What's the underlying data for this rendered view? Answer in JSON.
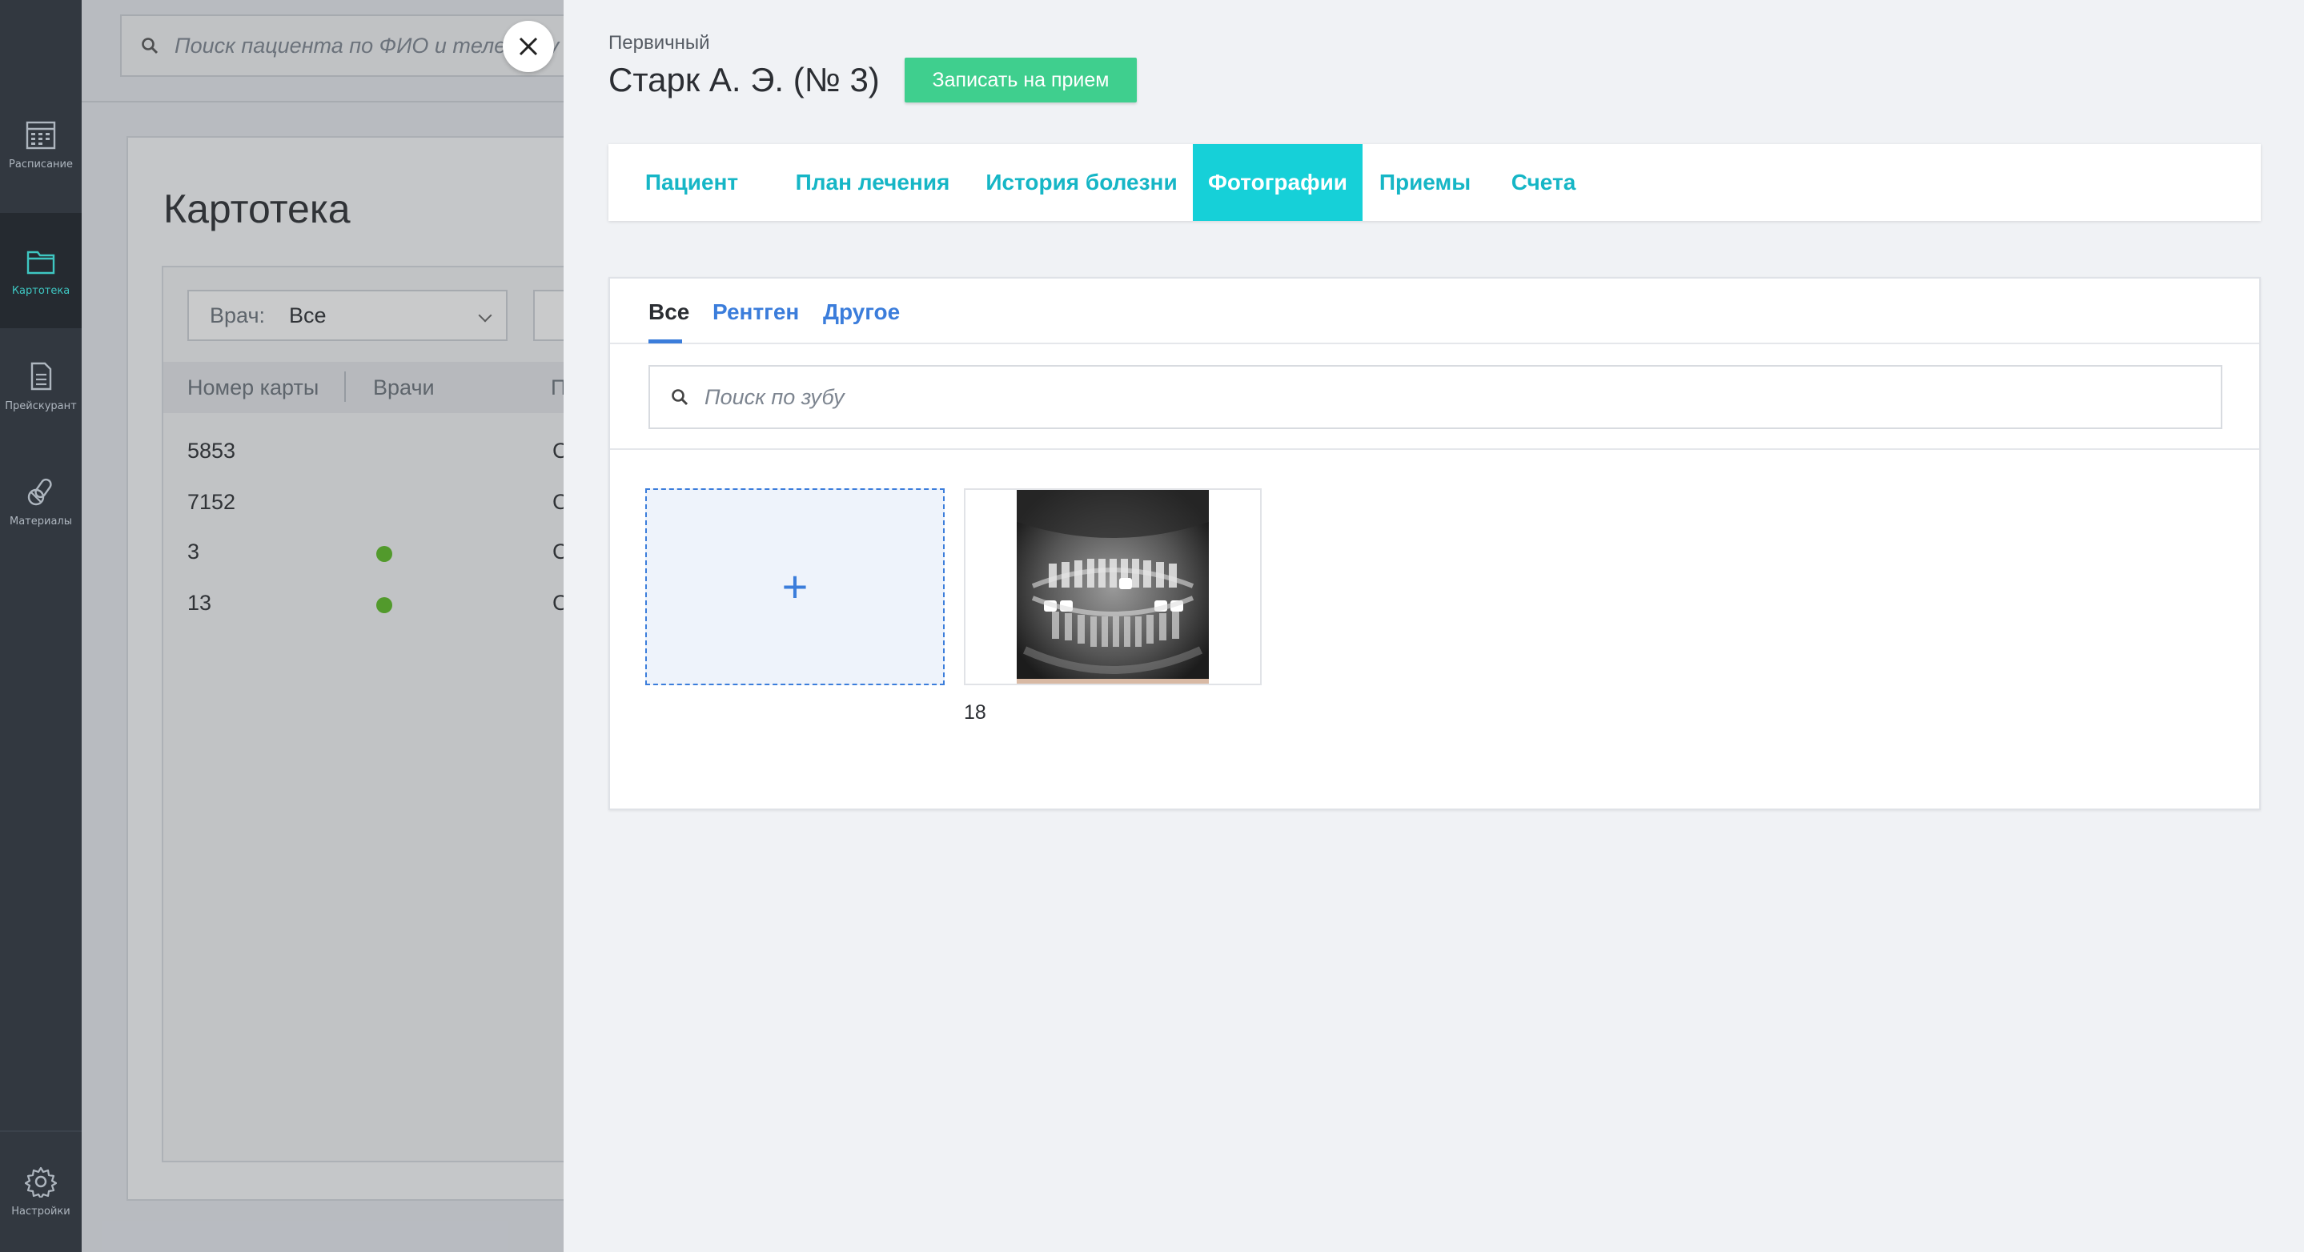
{
  "sidebar": {
    "items": [
      {
        "label": "Расписание",
        "icon": "calendar-icon"
      },
      {
        "label": "Картотека",
        "icon": "folder-icon",
        "active": true
      },
      {
        "label": "Прейскурант",
        "icon": "document-icon"
      },
      {
        "label": "Материалы",
        "icon": "pills-icon"
      }
    ],
    "settings_label": "Настройки"
  },
  "background": {
    "search_placeholder": "Поиск пациента по ФИО и телефону",
    "page_title": "Картотека",
    "filter": {
      "label": "Врач:",
      "value": "Все"
    },
    "table": {
      "headers": [
        "Номер карты",
        "Врачи",
        "П"
      ],
      "rows": [
        {
          "card": "5853",
          "doctor_dot": false,
          "status": "С"
        },
        {
          "card": "7152",
          "doctor_dot": false,
          "status": "С"
        },
        {
          "card": "3",
          "doctor_dot": true,
          "status": "С"
        },
        {
          "card": "13",
          "doctor_dot": true,
          "status": "С"
        }
      ]
    }
  },
  "drawer": {
    "subtitle": "Первичный",
    "title": "Старк А. Э. (№ 3)",
    "book_button": "Записать на прием",
    "tabs": [
      {
        "label": "Пациент"
      },
      {
        "label": "План лечения"
      },
      {
        "label": "История болезни"
      },
      {
        "label": "Фотографии",
        "active": true
      },
      {
        "label": "Приемы"
      },
      {
        "label": "Счета"
      }
    ],
    "photos": {
      "subtabs": [
        {
          "label": "Все",
          "active": true
        },
        {
          "label": "Рентген"
        },
        {
          "label": "Другое"
        }
      ],
      "search_placeholder": "Поиск по зубу",
      "add_symbol": "+",
      "items": [
        {
          "label": "18",
          "kind": "xray"
        }
      ]
    }
  },
  "colors": {
    "accent_teal": "#16d0d8",
    "book_button": "#3fcf8e",
    "link_blue": "#3b7ddb",
    "status_dot": "#5bbd23",
    "sidebar_bg": "#323840"
  }
}
